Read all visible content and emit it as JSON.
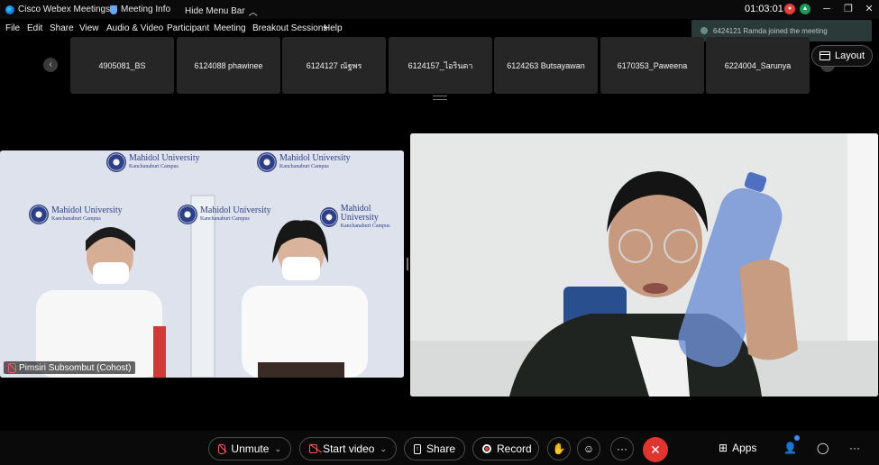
{
  "titlebar": {
    "app_name": "Cisco Webex Meetings",
    "meeting_info": "Meeting Info",
    "hide_menu": "Hide Menu Bar",
    "timer": "01:03:01",
    "minimize": "─",
    "restore": "❐",
    "close": "✕"
  },
  "menu": [
    "File",
    "Edit",
    "Share",
    "View",
    "Audio & Video",
    "Participant",
    "Meeting",
    "Breakout Sessions",
    "Help"
  ],
  "notification": "6424121 Ramda joined the meeting",
  "filmstrip": {
    "participants": [
      "4905081_BS",
      "6124088 phawinee",
      "6124127 ณัฐพร",
      "6124157_ไอรินดา",
      "6124263 Butsayawan",
      "6170353_Paweena",
      "6224004_Sarunya"
    ]
  },
  "layout_button": "Layout",
  "video_left": {
    "name_tag": "Pimsiri Subsombut (Cohost)",
    "banner_line1": "Mahidol University",
    "banner_line2": "Kanchanaburi Campus"
  },
  "controls": {
    "unmute": "Unmute",
    "start_video": "Start video",
    "share": "Share",
    "record": "Record",
    "apps": "Apps",
    "end_symbol": "✕",
    "more": "···"
  },
  "colors": {
    "end_button": "#e0342e",
    "muted_red": "#ff5b5b",
    "toast_bg": "#2a3a38"
  }
}
